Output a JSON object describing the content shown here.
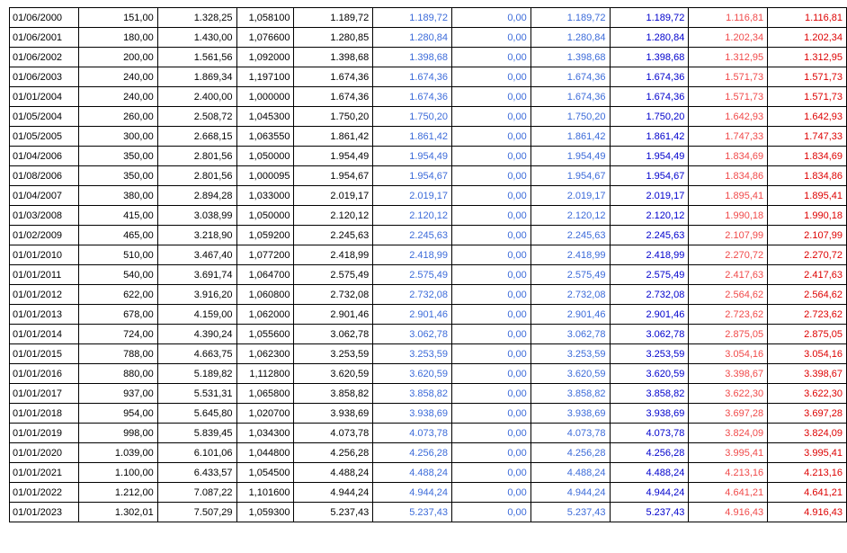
{
  "colors": {
    "blue_light": "#3c6bd9",
    "blue_dark": "#0000cc",
    "red_light": "#f04a4a",
    "red_dark": "#dd0000"
  },
  "rows": [
    [
      "01/06/2000",
      "151,00",
      "1.328,25",
      "1,058100",
      "1.189,72",
      "1.189,72",
      "0,00",
      "1.189,72",
      "1.189,72",
      "1.116,81",
      "1.116,81"
    ],
    [
      "01/06/2001",
      "180,00",
      "1.430,00",
      "1,076600",
      "1.280,85",
      "1.280,84",
      "0,00",
      "1.280,84",
      "1.280,84",
      "1.202,34",
      "1.202,34"
    ],
    [
      "01/06/2002",
      "200,00",
      "1.561,56",
      "1,092000",
      "1.398,68",
      "1.398,68",
      "0,00",
      "1.398,68",
      "1.398,68",
      "1.312,95",
      "1.312,95"
    ],
    [
      "01/06/2003",
      "240,00",
      "1.869,34",
      "1,197100",
      "1.674,36",
      "1.674,36",
      "0,00",
      "1.674,36",
      "1.674,36",
      "1.571,73",
      "1.571,73"
    ],
    [
      "01/01/2004",
      "240,00",
      "2.400,00",
      "1,000000",
      "1.674,36",
      "1.674,36",
      "0,00",
      "1.674,36",
      "1.674,36",
      "1.571,73",
      "1.571,73"
    ],
    [
      "01/05/2004",
      "260,00",
      "2.508,72",
      "1,045300",
      "1.750,20",
      "1.750,20",
      "0,00",
      "1.750,20",
      "1.750,20",
      "1.642,93",
      "1.642,93"
    ],
    [
      "01/05/2005",
      "300,00",
      "2.668,15",
      "1,063550",
      "1.861,42",
      "1.861,42",
      "0,00",
      "1.861,42",
      "1.861,42",
      "1.747,33",
      "1.747,33"
    ],
    [
      "01/04/2006",
      "350,00",
      "2.801,56",
      "1,050000",
      "1.954,49",
      "1.954,49",
      "0,00",
      "1.954,49",
      "1.954,49",
      "1.834,69",
      "1.834,69"
    ],
    [
      "01/08/2006",
      "350,00",
      "2.801,56",
      "1,000095",
      "1.954,67",
      "1.954,67",
      "0,00",
      "1.954,67",
      "1.954,67",
      "1.834,86",
      "1.834,86"
    ],
    [
      "01/04/2007",
      "380,00",
      "2.894,28",
      "1,033000",
      "2.019,17",
      "2.019,17",
      "0,00",
      "2.019,17",
      "2.019,17",
      "1.895,41",
      "1.895,41"
    ],
    [
      "01/03/2008",
      "415,00",
      "3.038,99",
      "1,050000",
      "2.120,12",
      "2.120,12",
      "0,00",
      "2.120,12",
      "2.120,12",
      "1.990,18",
      "1.990,18"
    ],
    [
      "01/02/2009",
      "465,00",
      "3.218,90",
      "1,059200",
      "2.245,63",
      "2.245,63",
      "0,00",
      "2.245,63",
      "2.245,63",
      "2.107,99",
      "2.107,99"
    ],
    [
      "01/01/2010",
      "510,00",
      "3.467,40",
      "1,077200",
      "2.418,99",
      "2.418,99",
      "0,00",
      "2.418,99",
      "2.418,99",
      "2.270,72",
      "2.270,72"
    ],
    [
      "01/01/2011",
      "540,00",
      "3.691,74",
      "1,064700",
      "2.575,49",
      "2.575,49",
      "0,00",
      "2.575,49",
      "2.575,49",
      "2.417,63",
      "2.417,63"
    ],
    [
      "01/01/2012",
      "622,00",
      "3.916,20",
      "1,060800",
      "2.732,08",
      "2.732,08",
      "0,00",
      "2.732,08",
      "2.732,08",
      "2.564,62",
      "2.564,62"
    ],
    [
      "01/01/2013",
      "678,00",
      "4.159,00",
      "1,062000",
      "2.901,46",
      "2.901,46",
      "0,00",
      "2.901,46",
      "2.901,46",
      "2.723,62",
      "2.723,62"
    ],
    [
      "01/01/2014",
      "724,00",
      "4.390,24",
      "1,055600",
      "3.062,78",
      "3.062,78",
      "0,00",
      "3.062,78",
      "3.062,78",
      "2.875,05",
      "2.875,05"
    ],
    [
      "01/01/2015",
      "788,00",
      "4.663,75",
      "1,062300",
      "3.253,59",
      "3.253,59",
      "0,00",
      "3.253,59",
      "3.253,59",
      "3.054,16",
      "3.054,16"
    ],
    [
      "01/01/2016",
      "880,00",
      "5.189,82",
      "1,112800",
      "3.620,59",
      "3.620,59",
      "0,00",
      "3.620,59",
      "3.620,59",
      "3.398,67",
      "3.398,67"
    ],
    [
      "01/01/2017",
      "937,00",
      "5.531,31",
      "1,065800",
      "3.858,82",
      "3.858,82",
      "0,00",
      "3.858,82",
      "3.858,82",
      "3.622,30",
      "3.622,30"
    ],
    [
      "01/01/2018",
      "954,00",
      "5.645,80",
      "1,020700",
      "3.938,69",
      "3.938,69",
      "0,00",
      "3.938,69",
      "3.938,69",
      "3.697,28",
      "3.697,28"
    ],
    [
      "01/01/2019",
      "998,00",
      "5.839,45",
      "1,034300",
      "4.073,78",
      "4.073,78",
      "0,00",
      "4.073,78",
      "4.073,78",
      "3.824,09",
      "3.824,09"
    ],
    [
      "01/01/2020",
      "1.039,00",
      "6.101,06",
      "1,044800",
      "4.256,28",
      "4.256,28",
      "0,00",
      "4.256,28",
      "4.256,28",
      "3.995,41",
      "3.995,41"
    ],
    [
      "01/01/2021",
      "1.100,00",
      "6.433,57",
      "1,054500",
      "4.488,24",
      "4.488,24",
      "0,00",
      "4.488,24",
      "4.488,24",
      "4.213,16",
      "4.213,16"
    ],
    [
      "01/01/2022",
      "1.212,00",
      "7.087,22",
      "1,101600",
      "4.944,24",
      "4.944,24",
      "0,00",
      "4.944,24",
      "4.944,24",
      "4.641,21",
      "4.641,21"
    ],
    [
      "01/01/2023",
      "1.302,01",
      "7.507,29",
      "1,059300",
      "5.237,43",
      "5.237,43",
      "0,00",
      "5.237,43",
      "5.237,43",
      "4.916,43",
      "4.916,43"
    ]
  ]
}
